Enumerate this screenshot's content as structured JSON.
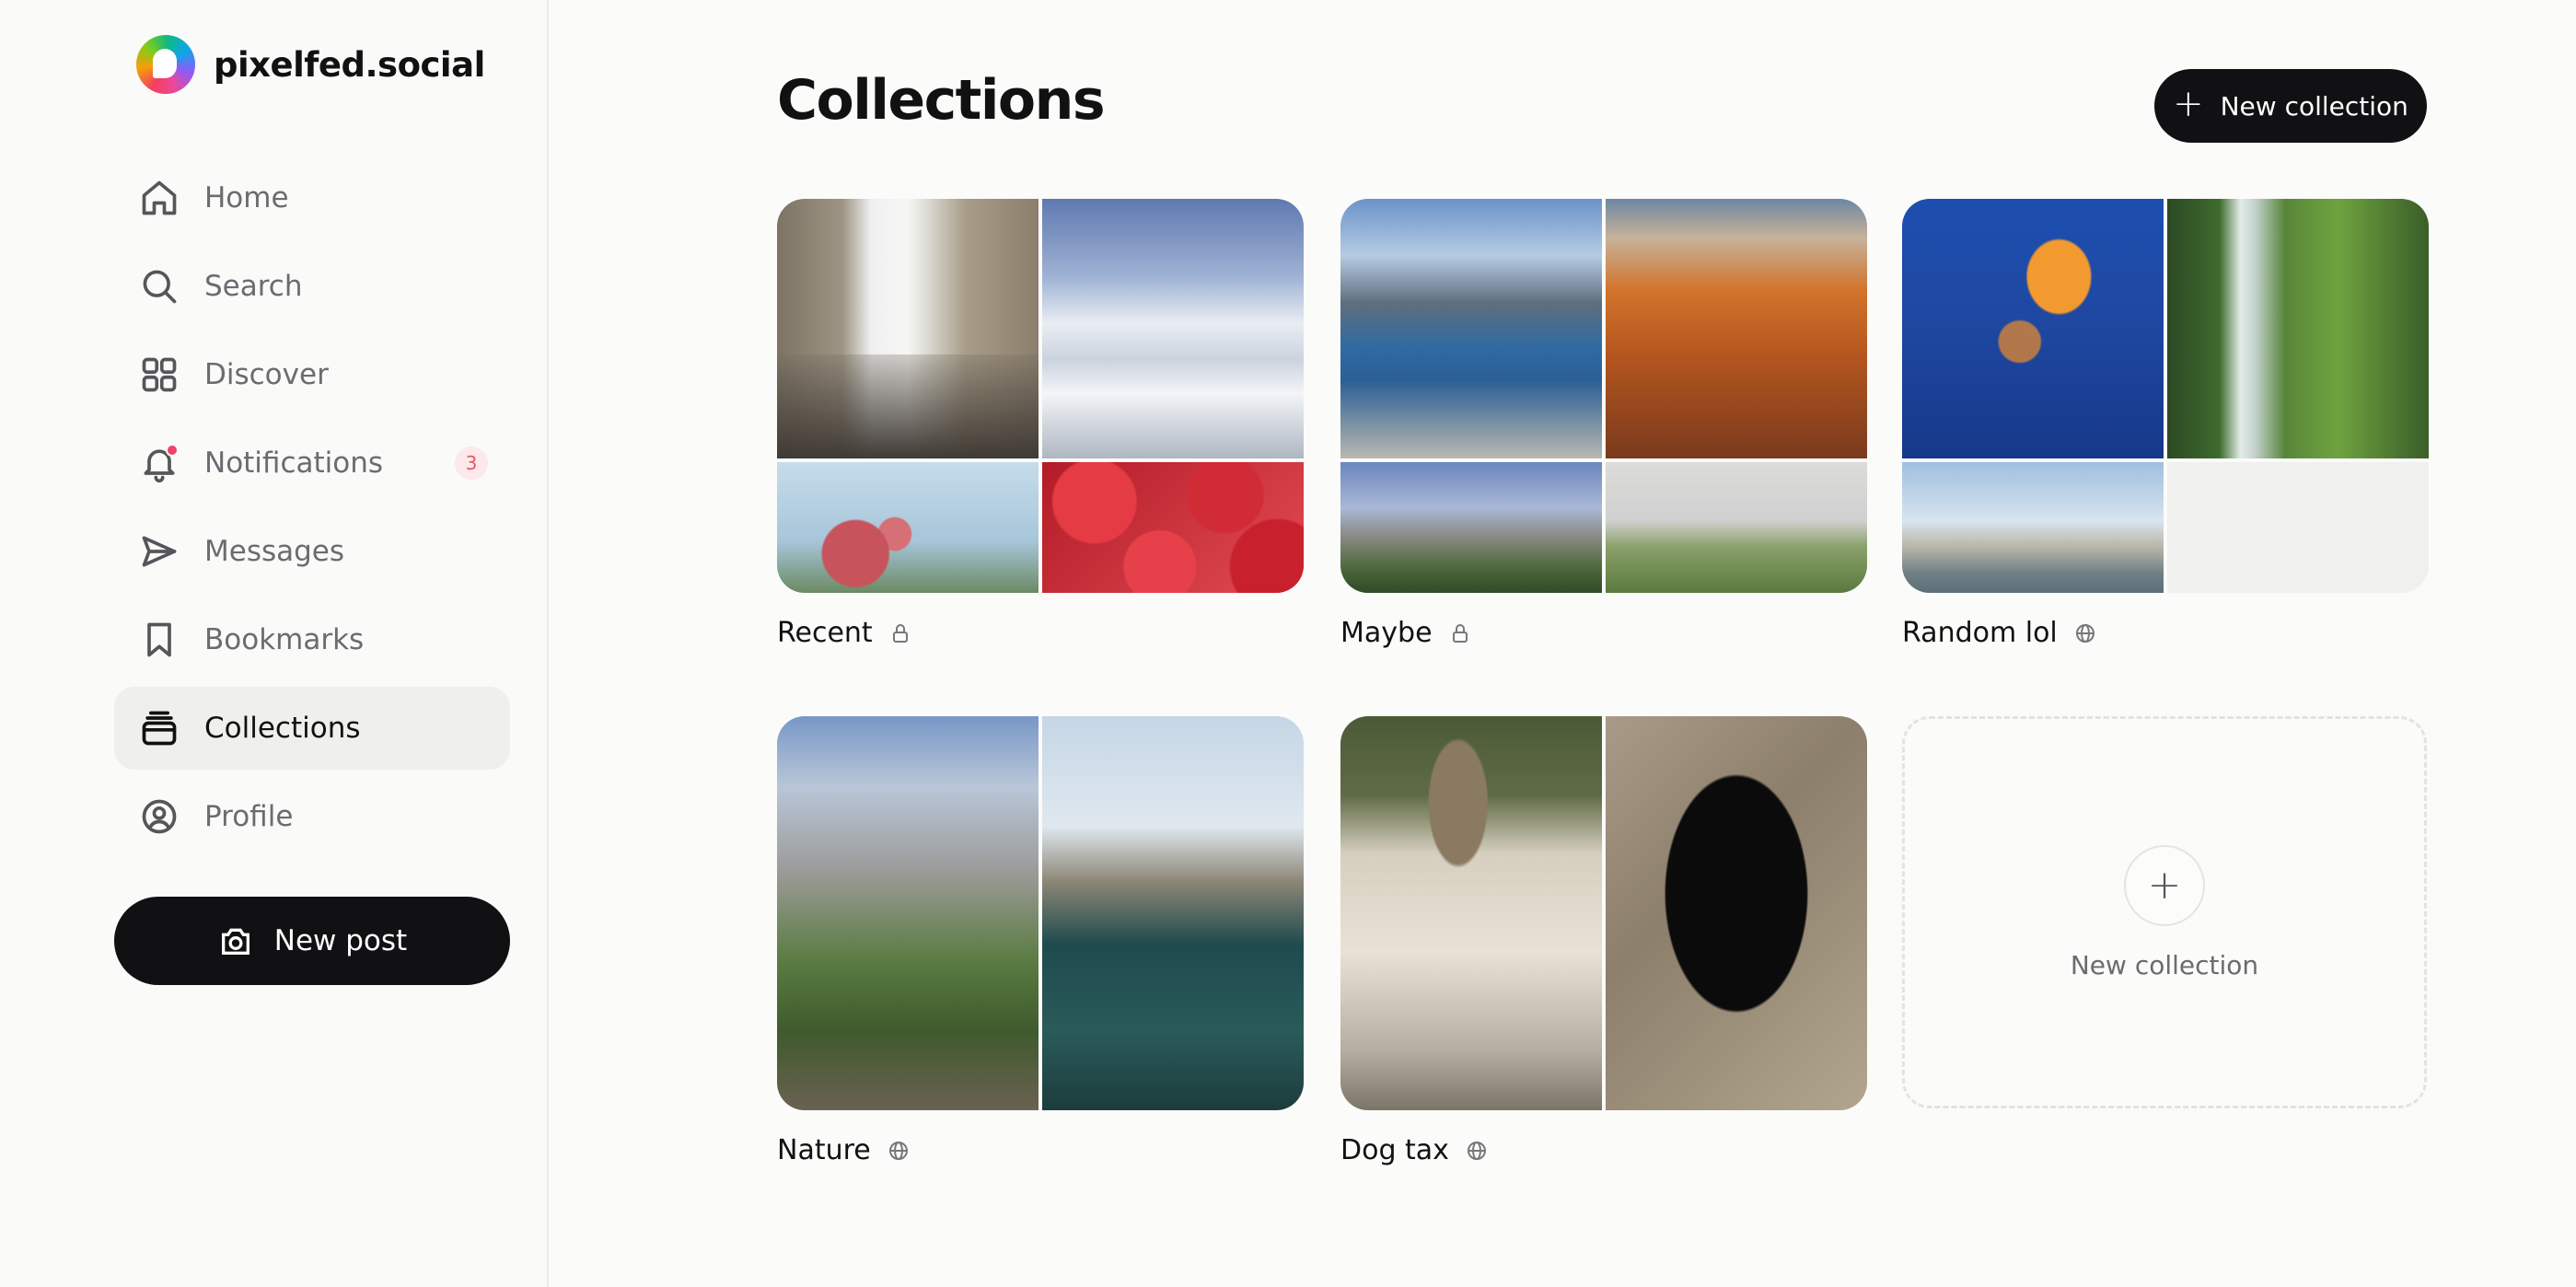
{
  "brand": {
    "name": "pixelfed.social"
  },
  "nav": {
    "items": [
      {
        "label": "Home",
        "icon": "home-icon"
      },
      {
        "label": "Search",
        "icon": "search-icon"
      },
      {
        "label": "Discover",
        "icon": "grid-icon"
      },
      {
        "label": "Notifications",
        "icon": "bell-icon",
        "badge": "3"
      },
      {
        "label": "Messages",
        "icon": "send-icon"
      },
      {
        "label": "Bookmarks",
        "icon": "bookmark-icon"
      },
      {
        "label": "Collections",
        "icon": "collections-icon",
        "active": true
      },
      {
        "label": "Profile",
        "icon": "user-circle-icon"
      }
    ],
    "new_post": "New post"
  },
  "header": {
    "title": "Collections",
    "new_collection": "New collection"
  },
  "collections": [
    {
      "title": "Recent",
      "visibility": "lock-icon"
    },
    {
      "title": "Maybe",
      "visibility": "lock-icon"
    },
    {
      "title": "Random lol",
      "visibility": "globe-icon"
    },
    {
      "title": "Nature",
      "visibility": "globe-icon"
    },
    {
      "title": "Dog tax",
      "visibility": "globe-icon"
    }
  ],
  "new_collection_card": {
    "label": "New collection",
    "icon": "plus-icon"
  },
  "colors": {
    "accent": "#111113",
    "notification_dot": "#ef4466",
    "badge_bg": "#fde8ea",
    "badge_text": "#e4586c",
    "active_nav_bg": "#efefec"
  }
}
